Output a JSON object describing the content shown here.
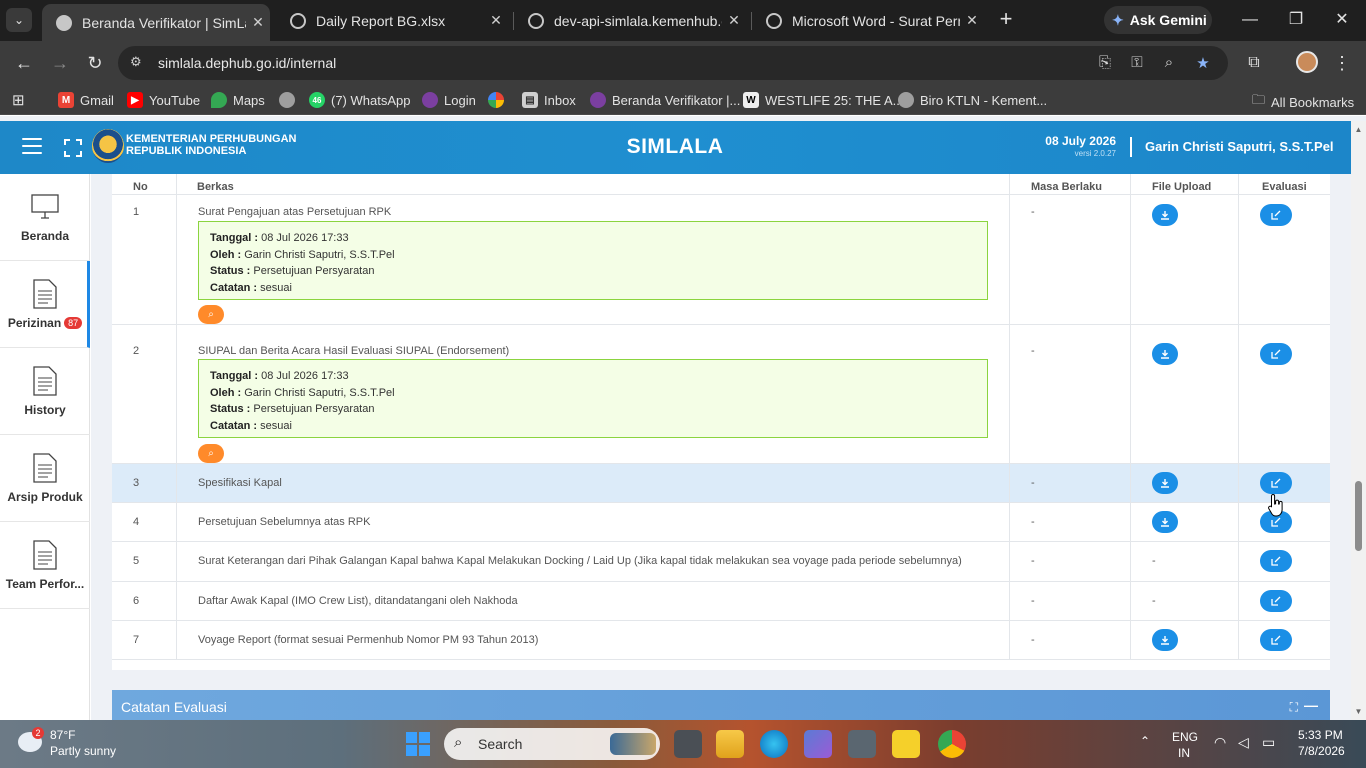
{
  "browser": {
    "tabs": [
      {
        "title": "Beranda Verifikator | SimLala",
        "active": true
      },
      {
        "title": "Daily Report BG.xlsx",
        "active": false
      },
      {
        "title": "dev-api-simlala.kemenhub.go.id",
        "active": false
      },
      {
        "title": "Microsoft Word - Surat Permoh",
        "active": false
      }
    ],
    "tab_close": "✕",
    "new_tab": "+",
    "gemini_label": "Ask Gemini",
    "url": "simlala.dephub.go.id/internal",
    "bookmarks": [
      {
        "label": "Gmail",
        "icon": "gmail-icon"
      },
      {
        "label": "YouTube",
        "icon": "youtube-icon"
      },
      {
        "label": "Maps",
        "icon": "maps-icon"
      },
      {
        "label": "",
        "icon": "globe-icon"
      },
      {
        "label": "(7) WhatsApp",
        "icon": "whatsapp-icon",
        "badge": "46"
      },
      {
        "label": "Login",
        "icon": "login-icon"
      },
      {
        "label": "",
        "icon": "photos-icon"
      },
      {
        "label": "Inbox",
        "icon": "inbox-icon"
      },
      {
        "label": "Beranda Verifikator |...",
        "icon": "simlala-icon"
      },
      {
        "label": "WESTLIFE 25: THE A...",
        "icon": "westlife-icon"
      },
      {
        "label": "Biro KTLN - Kement...",
        "icon": "globe-icon"
      }
    ],
    "all_bookmarks": "All Bookmarks"
  },
  "header": {
    "ministry_line1": "KEMENTERIAN PERHUBUNGAN",
    "ministry_line2": "REPUBLIK INDONESIA",
    "brand": "SIMLALA",
    "date": "08 July 2026",
    "version": "versi 2.0.27",
    "user": "Garin Christi Saputri, S.S.T.Pel"
  },
  "sidebar": {
    "items": [
      {
        "label": "Beranda",
        "icon": "monitor-icon"
      },
      {
        "label": "Perizinan",
        "icon": "document-icon",
        "badge": "87",
        "active": true
      },
      {
        "label": "History",
        "icon": "document-icon"
      },
      {
        "label": "Arsip Produk",
        "icon": "document-icon"
      },
      {
        "label": "Team Perfor...",
        "icon": "document-icon"
      }
    ]
  },
  "table": {
    "columns": [
      "No",
      "Berkas",
      "Masa Berlaku",
      "File Upload",
      "Evaluasi"
    ],
    "note_labels": {
      "tanggal": "Tanggal :",
      "oleh": "Oleh :",
      "status": "Status :",
      "catatan": "Catatan :"
    },
    "rows": [
      {
        "no": "1",
        "berkas": "Surat Pengajuan atas Persetujuan RPK",
        "note": {
          "tanggal": "08 Jul 2026 17:33",
          "oleh": "Garin Christi Saputri, S.S.T.Pel",
          "status": "Persetujuan Persyaratan",
          "catatan": "sesuai"
        },
        "masa_berlaku": "-",
        "file_upload": "download"
      },
      {
        "no": "2",
        "berkas": "SIUPAL dan Berita Acara Hasil Evaluasi SIUPAL (Endorsement)",
        "note": {
          "tanggal": "08 Jul 2026 17:33",
          "oleh": "Garin Christi Saputri, S.S.T.Pel",
          "status": "Persetujuan Persyaratan",
          "catatan": "sesuai"
        },
        "masa_berlaku": "-",
        "file_upload": "download"
      },
      {
        "no": "3",
        "berkas": "Spesifikasi Kapal",
        "masa_berlaku": "-",
        "file_upload": "download",
        "highlighted": true
      },
      {
        "no": "4",
        "berkas": "Persetujuan Sebelumnya atas RPK",
        "masa_berlaku": "-",
        "file_upload": "download"
      },
      {
        "no": "5",
        "berkas": "Surat Keterangan dari Pihak Galangan Kapal bahwa Kapal Melakukan Docking / Laid Up (Jika kapal tidak melakukan sea voyage pada periode sebelumnya)",
        "masa_berlaku": "-",
        "file_upload": "-"
      },
      {
        "no": "6",
        "berkas": "Daftar Awak Kapal (IMO Crew List), ditandatangani oleh Nakhoda",
        "masa_berlaku": "-",
        "file_upload": "-"
      },
      {
        "no": "7",
        "berkas": "Voyage Report (format sesuai Permenhub Nomor PM 93 Tahun 2013)",
        "masa_berlaku": "-",
        "file_upload": "download"
      }
    ]
  },
  "evaluation_panel": {
    "title": "Catatan Evaluasi"
  },
  "taskbar": {
    "weather_badge": "2",
    "temperature": "87°F",
    "weather": "Partly sunny",
    "search_label": "Search",
    "lang_line1": "ENG",
    "lang_line2": "IN",
    "time": "5:33 PM",
    "date": "7/8/2026"
  },
  "colors": {
    "accent": "#1b8fe6",
    "header": "#1e88c8",
    "note_bg": "#f4fee6",
    "note_border": "#8bd43f",
    "search_btn": "#ff8a2a",
    "row_highlight": "#dcebf9"
  }
}
